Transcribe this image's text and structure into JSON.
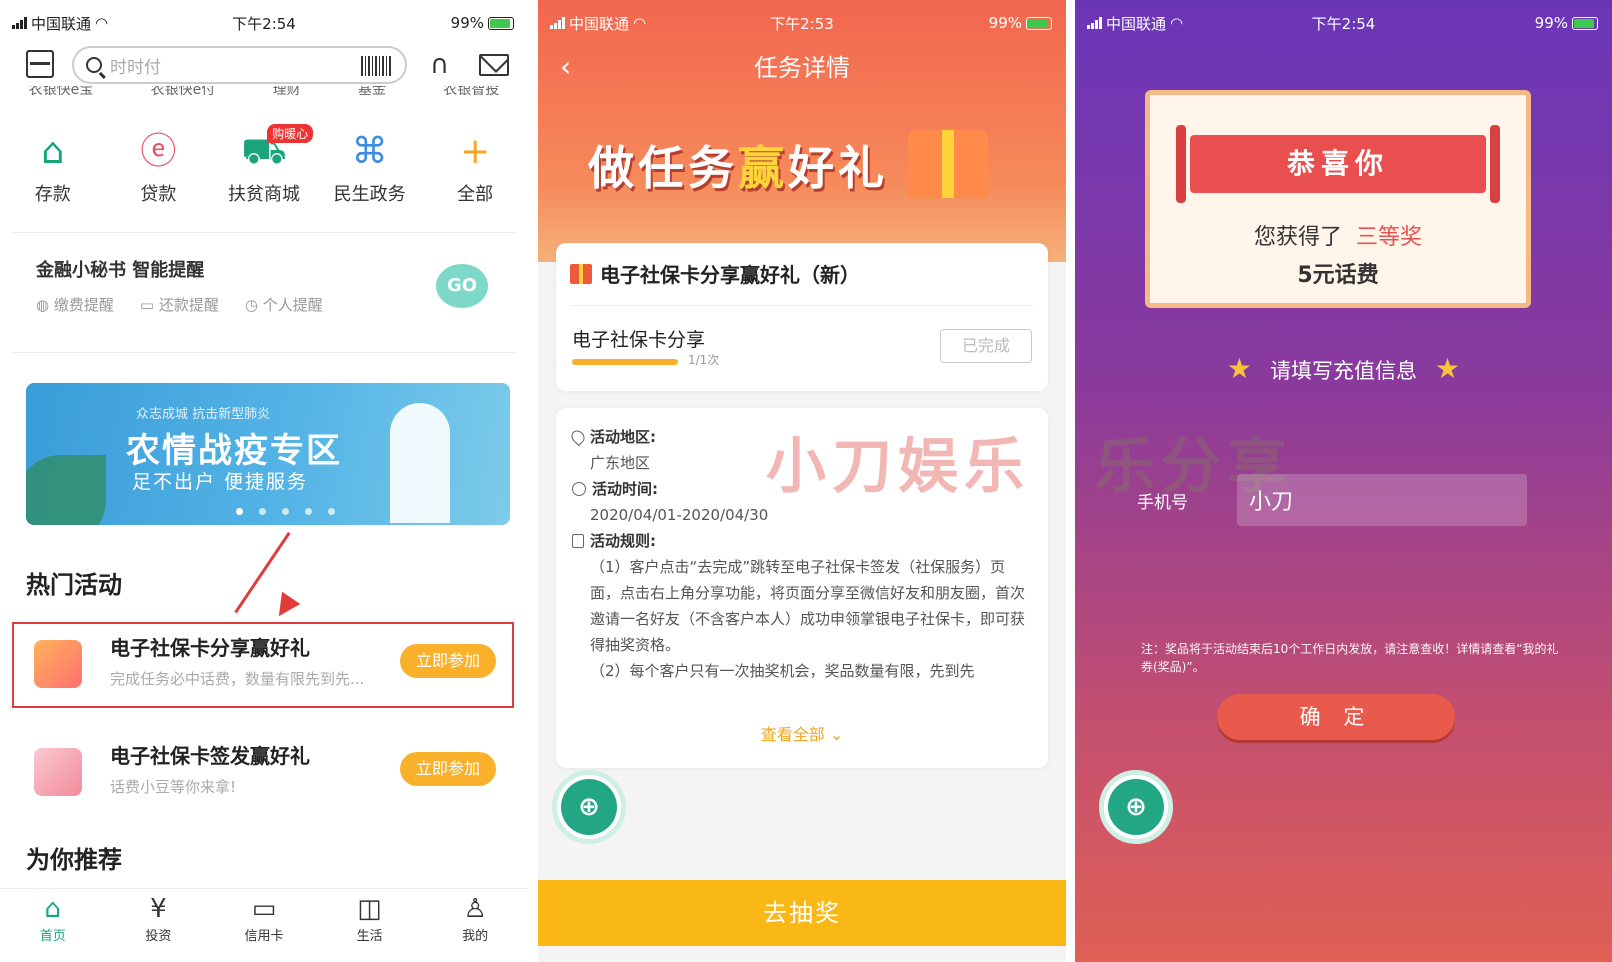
{
  "panel1": {
    "status": {
      "carrier": "中国联通",
      "time": "下午2:54",
      "battery": "99%"
    },
    "search_placeholder": "时时付",
    "cut_row": [
      "农银快e宝",
      "农银快e付",
      "理财",
      "基金",
      "农银智投"
    ],
    "quick": [
      {
        "icon": "deposit-icon",
        "label": "存款"
      },
      {
        "icon": "loan-icon",
        "label": "贷款"
      },
      {
        "icon": "mall-cart-icon",
        "label": "扶贫商城",
        "tag": "购暖心"
      },
      {
        "icon": "government-icon",
        "label": "民生政务"
      },
      {
        "icon": "plus-icon",
        "label": "全部"
      }
    ],
    "reminder": {
      "title": "金融小秘书 智能提醒",
      "options": [
        "缴费提醒",
        "还款提醒",
        "个人提醒"
      ],
      "go": "GO"
    },
    "banner": {
      "small": "众志成城 抗击新型肺炎",
      "big": "农情战疫专区",
      "sub": "足不出户  便捷服务"
    },
    "hot_title": "热门活动",
    "activities": [
      {
        "name": "电子社保卡分享赢好礼",
        "desc": "完成任务必中话费，数量有限先到先...",
        "join": "立即参加"
      },
      {
        "name": "电子社保卡签发赢好礼",
        "desc": "话费小豆等你来拿!",
        "join": "立即参加"
      }
    ],
    "rec_title": "为你推荐",
    "tabs": [
      {
        "icon": "home-icon",
        "label": "首页"
      },
      {
        "icon": "invest-icon",
        "label": "投资"
      },
      {
        "icon": "credit-card-icon",
        "label": "信用卡"
      },
      {
        "icon": "shopping-bag-icon",
        "label": "生活"
      },
      {
        "icon": "user-icon",
        "label": "我的"
      }
    ]
  },
  "panel2": {
    "status": {
      "carrier": "中国联通",
      "time": "下午2:53",
      "battery": "99%"
    },
    "title": "任务详情",
    "slogan_a": "做任务",
    "slogan_b": "赢",
    "slogan_c": "好礼",
    "task_title": "电子社保卡分享赢好礼（新）",
    "task_name": "电子社保卡分享",
    "task_progress": "1/1次",
    "task_progress_fraction": 1.0,
    "task_status": "已完成",
    "area_label": "活动地区:",
    "area_value": "广东地区",
    "time_label": "活动时间:",
    "time_value": "2020/04/01-2020/04/30",
    "rules_label": "活动规则:",
    "rule1": "（1）客户点击“去完成”跳转至电子社保卡签发（社保服务）页面，点击右上角分享功能，将页面分享至微信好友和朋友圈，首次邀请一名好友（不含客户本人）成功申领掌银电子社保卡，即可获得抽奖资格。",
    "rule2": "（2）每个客户只有一次抽奖机会，奖品数量有限，先到先",
    "view_all": "查看全部",
    "watermark": "小刀娱乐",
    "draw_button": "去抽奖"
  },
  "panel3": {
    "status": {
      "carrier": "中国联通",
      "time": "下午2:54",
      "battery": "99%"
    },
    "congrats": "恭喜你",
    "won_prefix": "您获得了",
    "won_prize": "三等奖",
    "won_value": "5元话费",
    "fill_title": "请填写充值信息",
    "phone_label": "手机号",
    "phone_value": "小刀",
    "watermark": "乐分享",
    "note": "注：奖品将于活动结束后10个工作日内发放，请注意查收！详情请查看“我的礼券(奖品)”。",
    "confirm": "确 定"
  }
}
